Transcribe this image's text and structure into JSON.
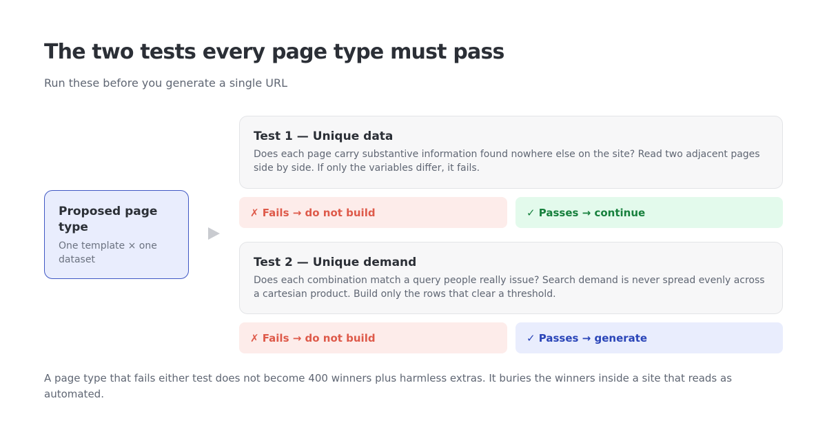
{
  "header": {
    "title": "The two tests every page type must pass",
    "subtitle": "Run these before you generate a single URL"
  },
  "source": {
    "title": "Proposed page type",
    "description": "One template × one dataset"
  },
  "arrow_icon": "play-triangle-icon",
  "tests": [
    {
      "title": "Test 1 — Unique data",
      "description": "Does each page carry substantive information found nowhere else on the site? Read two adjacent pages side by side. If only the variables differ, it fails.",
      "fail": "✗ Fails → do not build",
      "pass": "✓ Passes → continue"
    },
    {
      "title": "Test 2 — Unique demand",
      "description": "Does each combination match a query people really issue? Search demand is never spread evenly across a cartesian product. Build only the rows that clear a threshold.",
      "fail": "✗ Fails → do not build",
      "pass": "✓ Passes → generate"
    }
  ],
  "footnote": "A page type that fails either test does not become 400 winners plus harmless extras. It buries the winners inside a site that reads as automated.",
  "colors": {
    "accent_blue": "#3f57c4",
    "fail_red": "#de5a4a",
    "pass_green": "#17803d",
    "pass_blue": "#2a45b8"
  }
}
